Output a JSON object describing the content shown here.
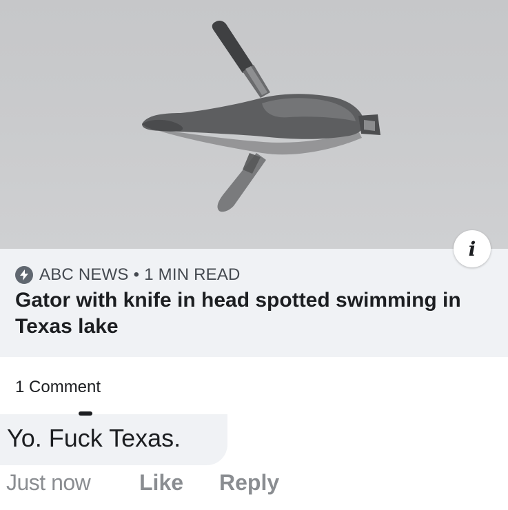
{
  "post": {
    "image_alt": "Alligator with a knife stuck in its head swimming in a lake",
    "info_icon": "info-icon"
  },
  "link_preview": {
    "source_icon": "bolt-icon",
    "source": "ABC NEWS",
    "separator": "•",
    "read_time": "1 MIN READ",
    "headline": "Gator with knife in head spotted swimming in Texas lake"
  },
  "comments": {
    "count_label": "1 Comment",
    "items": [
      {
        "text": "Yo. Fuck Texas.",
        "timestamp": "Just now",
        "like_label": "Like",
        "reply_label": "Reply"
      }
    ]
  },
  "colors": {
    "panel_bg": "#f0f2f5",
    "text_primary": "#1c1e21",
    "text_secondary": "#8a8d91"
  }
}
